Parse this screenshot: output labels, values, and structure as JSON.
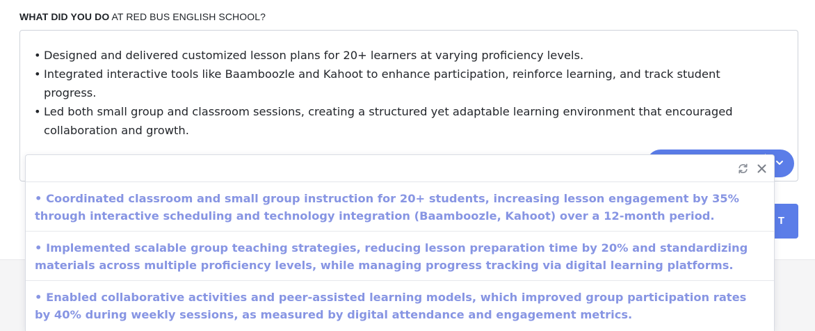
{
  "question": {
    "strong": "WHAT DID YOU DO",
    "rest": " AT RED BUS ENGLISH SCHOOL?"
  },
  "editor": {
    "bullets": [
      "Designed and delivered customized lesson plans for 20+ learners at varying proficiency levels.",
      "Integrated interactive tools like Baamboozle and Kahoot to enhance participation, reinforce learning, and track student progress.",
      "Led both small group and classroom sessions, creating a structured yet adaptable learning environment that encouraged collaboration and growth."
    ]
  },
  "right_button": {
    "label_visible": "T"
  },
  "dropdown": {
    "icons": {
      "refresh": "refresh-icon",
      "close": "close-icon"
    },
    "suggestions": [
      "• Coordinated classroom and small group instruction for 20+ students, increasing lesson engagement by 35% through interactive scheduling and technology integration (Baamboozle, Kahoot) over a 12-month period.",
      "• Implemented scalable group teaching strategies, reducing lesson preparation time by 20% and standardizing materials across multiple proficiency levels, while managing progress tracking via digital learning platforms.",
      "• Enabled collaborative activities and peer-assisted learning models, which improved group participation rates by 40% during weekly sessions, as measured by digital attendance and engagement metrics."
    ]
  },
  "colors": {
    "accent": "#5b7de8",
    "suggestion_text": "#8795e3"
  }
}
